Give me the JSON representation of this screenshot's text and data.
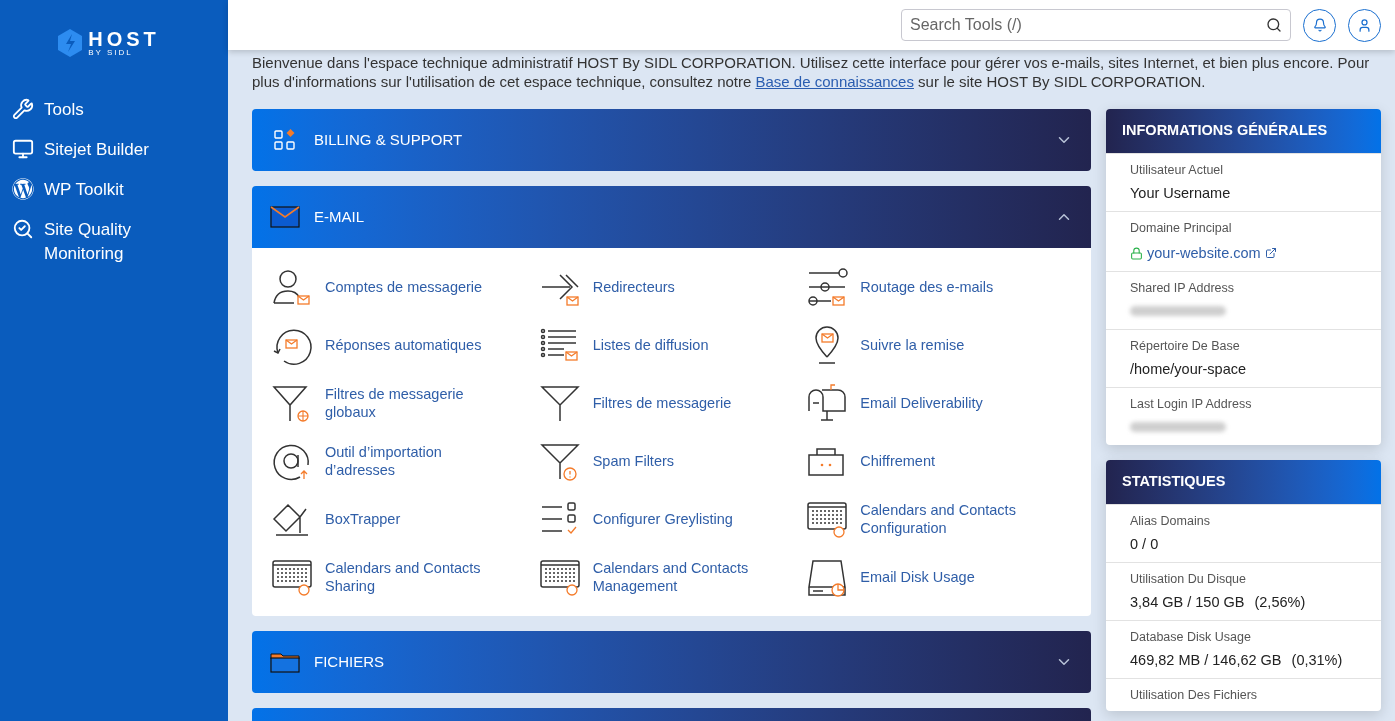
{
  "sidebar": {
    "logo": {
      "title": "HOST",
      "subtitle": "BY SIDL"
    },
    "items": [
      {
        "label": "Tools",
        "kind": "tools"
      },
      {
        "label": "Sitejet Builder",
        "kind": "builder"
      },
      {
        "label": "WP Toolkit",
        "kind": "wordpress"
      },
      {
        "label": "Site Quality Monitoring",
        "kind": "quality"
      }
    ]
  },
  "header": {
    "search": {
      "placeholder": "Search Tools (/)"
    }
  },
  "intro": {
    "text_before": "Bienvenue dans l'espace technique administratif HOST By SIDL CORPORATION. Utilisez cette interface pour gérer vos e-mails, sites Internet, et bien plus encore. Pour plus d'informations sur l'utilisation de cet espace technique, consultez notre ",
    "link": "Base de connaissances",
    "text_after": " sur le site HOST By SIDL CORPORATION."
  },
  "sections": [
    {
      "title": "BILLING & SUPPORT",
      "kind": "billing",
      "expanded": false
    },
    {
      "title": "E-MAIL",
      "kind": "email",
      "expanded": true,
      "items": [
        {
          "label": "Comptes de messagerie"
        },
        {
          "label": "Redirecteurs"
        },
        {
          "label": "Routage des e-mails"
        },
        {
          "label": "Réponses automatiques"
        },
        {
          "label": "Listes de diffusion"
        },
        {
          "label": "Suivre la remise"
        },
        {
          "label": "Filtres de messagerie globaux"
        },
        {
          "label": "Filtres de messagerie"
        },
        {
          "label": "Email Deliverability"
        },
        {
          "label": "Outil d’importation d’adresses"
        },
        {
          "label": "Spam Filters"
        },
        {
          "label": "Chiffrement"
        },
        {
          "label": "BoxTrapper"
        },
        {
          "label": "Configurer Greylisting"
        },
        {
          "label": "Calendars and Contacts Configuration"
        },
        {
          "label": "Calendars and Contacts Sharing"
        },
        {
          "label": "Calendars and Contacts Management"
        },
        {
          "label": "Email Disk Usage"
        }
      ]
    },
    {
      "title": "FICHIERS",
      "kind": "files",
      "expanded": false
    },
    {
      "kind": "partial"
    }
  ],
  "panels": [
    {
      "title": "INFORMATIONS GÉNÉRALES",
      "rows": [
        {
          "label": "Utilisateur Actuel",
          "kind": "text",
          "value": "Your Username"
        },
        {
          "label": "Domaine Principal",
          "kind": "link",
          "value": "your-website.com"
        },
        {
          "label": "Shared IP Address",
          "kind": "blurred"
        },
        {
          "label": "Répertoire De Base",
          "kind": "text",
          "value": "/home/your-space"
        },
        {
          "label": "Last Login IP Address",
          "kind": "blurred"
        }
      ]
    },
    {
      "title": "STATISTIQUES",
      "rows": [
        {
          "label": "Alias Domains",
          "kind": "text",
          "value": "0 / 0"
        },
        {
          "label": "Utilisation Du Disque",
          "kind": "text",
          "value": "3,84 GB / 150 GB",
          "percent": "(2,56%)"
        },
        {
          "label": "Database Disk Usage",
          "kind": "text",
          "value": "469,82 MB / 146,62 GB",
          "percent": "(0,31%)"
        },
        {
          "label": "Utilisation Des Fichiers",
          "kind": "label"
        }
      ]
    }
  ]
}
